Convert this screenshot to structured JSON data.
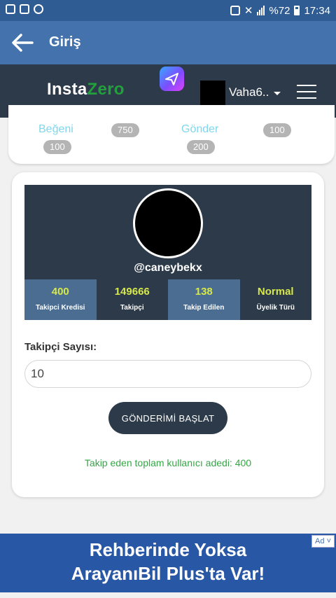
{
  "status_bar": {
    "battery": "%72",
    "time": "17:34"
  },
  "app_bar": {
    "title": "Giriş"
  },
  "site_header": {
    "logo_part1": "Insta",
    "logo_part2": "Zero",
    "username": "Vaha6.."
  },
  "packages": [
    {
      "label": "Beğeni",
      "amount_a": "750",
      "amount_b": "100"
    },
    {
      "label": "Gönder",
      "amount_a": "100",
      "amount_b": "200"
    }
  ],
  "profile": {
    "handle": "@caneybekx",
    "stats": [
      {
        "value": "400",
        "label": "Takipci Kredisi"
      },
      {
        "value": "149666",
        "label": "Takipçi"
      },
      {
        "value": "138",
        "label": "Takip Edilen"
      },
      {
        "value": "Normal",
        "label": "Üyelik Türü"
      }
    ]
  },
  "form": {
    "label": "Takipçi Sayısı:",
    "value": "10",
    "button_label": "GÖNDERİMİ BAŞLAT",
    "total_text": "Takip eden toplam kullanıcı adedi: 400"
  },
  "ad": {
    "line1": "Rehberinde Yoksa",
    "line2": "ArayanıBil Plus'ta Var!",
    "badge": "Ad"
  },
  "colors": {
    "app_bar": "#4472ad",
    "header": "#2d3a49",
    "accent_green": "#22a03c",
    "stat_value": "#d7e84b"
  }
}
